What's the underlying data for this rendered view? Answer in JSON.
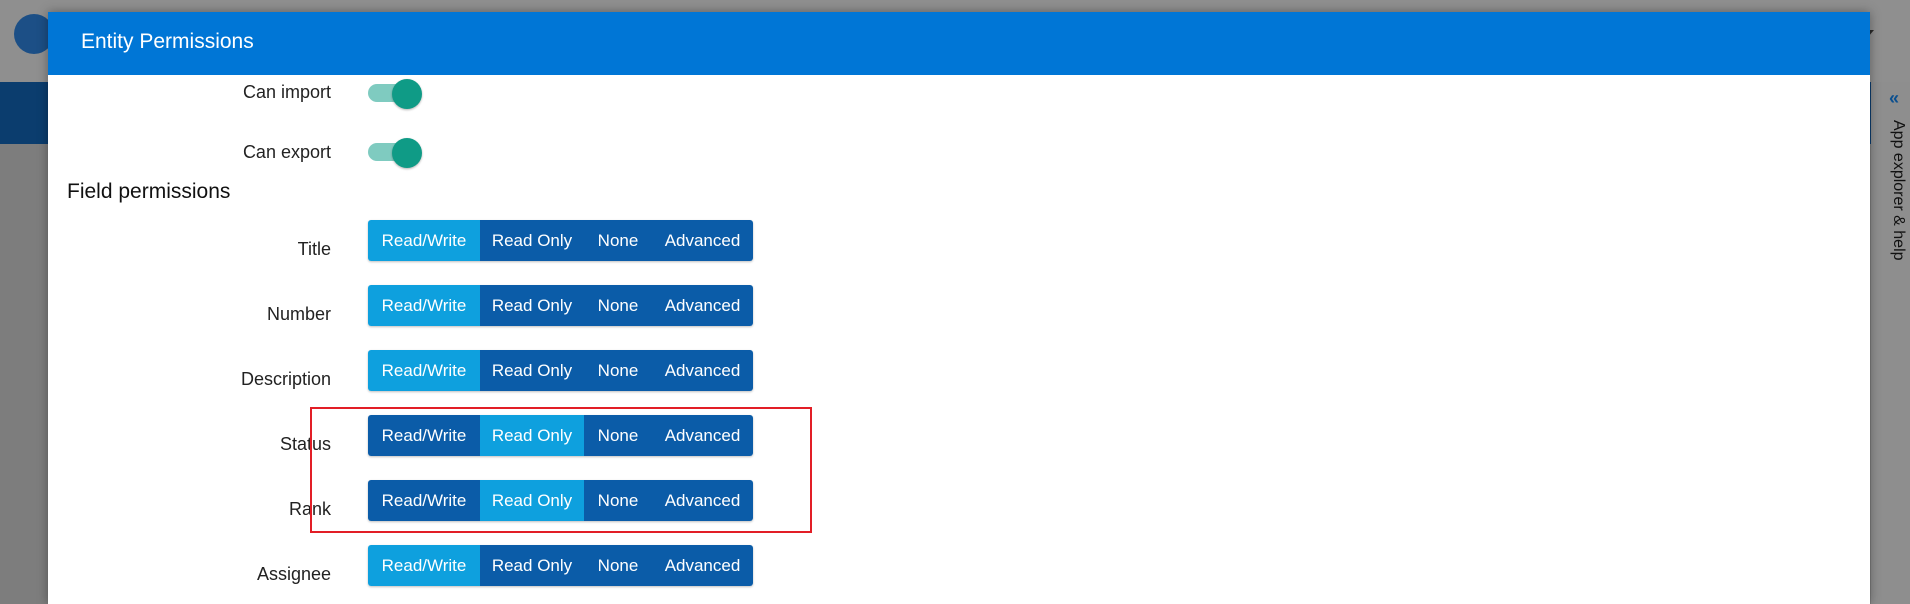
{
  "modal": {
    "title": "Entity Permissions"
  },
  "sidebar": {
    "label": "App explorer & help"
  },
  "toggles": [
    {
      "label": "Can import",
      "on": true
    },
    {
      "label": "Can export",
      "on": true
    }
  ],
  "field_permissions": {
    "title": "Field permissions",
    "options": [
      "Read/Write",
      "Read Only",
      "None",
      "Advanced"
    ],
    "rows": [
      {
        "label": "Title",
        "selected": "Read/Write"
      },
      {
        "label": "Number",
        "selected": "Read/Write"
      },
      {
        "label": "Description",
        "selected": "Read/Write"
      },
      {
        "label": "Status",
        "selected": "Read Only"
      },
      {
        "label": "Rank",
        "selected": "Read Only"
      },
      {
        "label": "Assignee",
        "selected": "Read/Write"
      }
    ]
  },
  "colors": {
    "header": "#0076d6",
    "segment": "#0b5ca8",
    "segment_active": "#0ea0de",
    "toggle": "#0f9b86",
    "highlight": "#e21e26"
  }
}
